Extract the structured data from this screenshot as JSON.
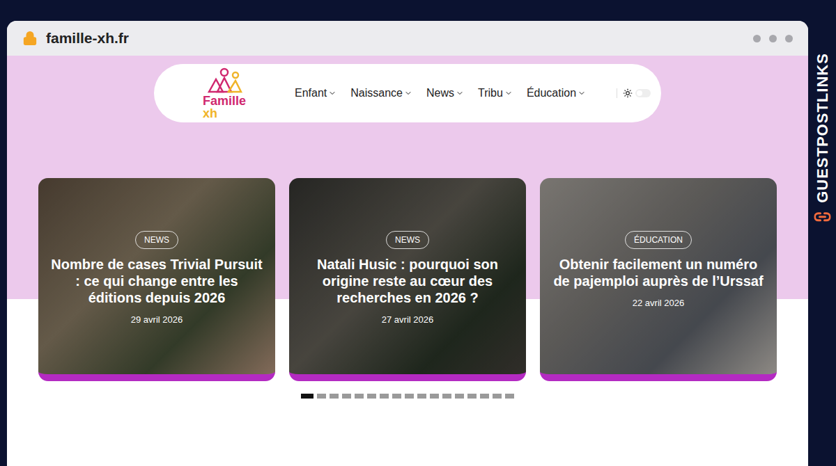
{
  "browser": {
    "url": "famille-xh.fr"
  },
  "logo": {
    "name": "Famille",
    "suffix": "xh"
  },
  "nav": [
    {
      "label": "Enfant"
    },
    {
      "label": "Naissance"
    },
    {
      "label": "News"
    },
    {
      "label": "Tribu"
    },
    {
      "label": "Éducation"
    }
  ],
  "theme_toggle": {
    "on": false
  },
  "cards": [
    {
      "category": "NEWS",
      "title": "Nombre de cases Trivial Pursuit : ce qui change entre les éditions depuis 2026",
      "date": "29 avril 2026"
    },
    {
      "category": "NEWS",
      "title": "Natali Husic : pourquoi son origine reste au cœur des recherches en 2026 ?",
      "date": "27 avril 2026"
    },
    {
      "category": "ÉDUCATION",
      "title": "Obtenir facilement un numéro de pajemploi auprès de l’Urssaf",
      "date": "22 avril 2026"
    }
  ],
  "pagination": [
    {
      "selected": true
    },
    {
      "selected": false
    },
    {
      "selected": false
    },
    {
      "selected": false
    },
    {
      "selected": false
    },
    {
      "selected": false
    },
    {
      "selected": false
    },
    {
      "selected": false
    },
    {
      "selected": false
    },
    {
      "selected": false
    },
    {
      "selected": false
    },
    {
      "selected": false
    },
    {
      "selected": false
    },
    {
      "selected": false
    },
    {
      "selected": false
    },
    {
      "selected": false
    },
    {
      "selected": false
    }
  ],
  "watermark": "GUESTPOSTLINKS"
}
